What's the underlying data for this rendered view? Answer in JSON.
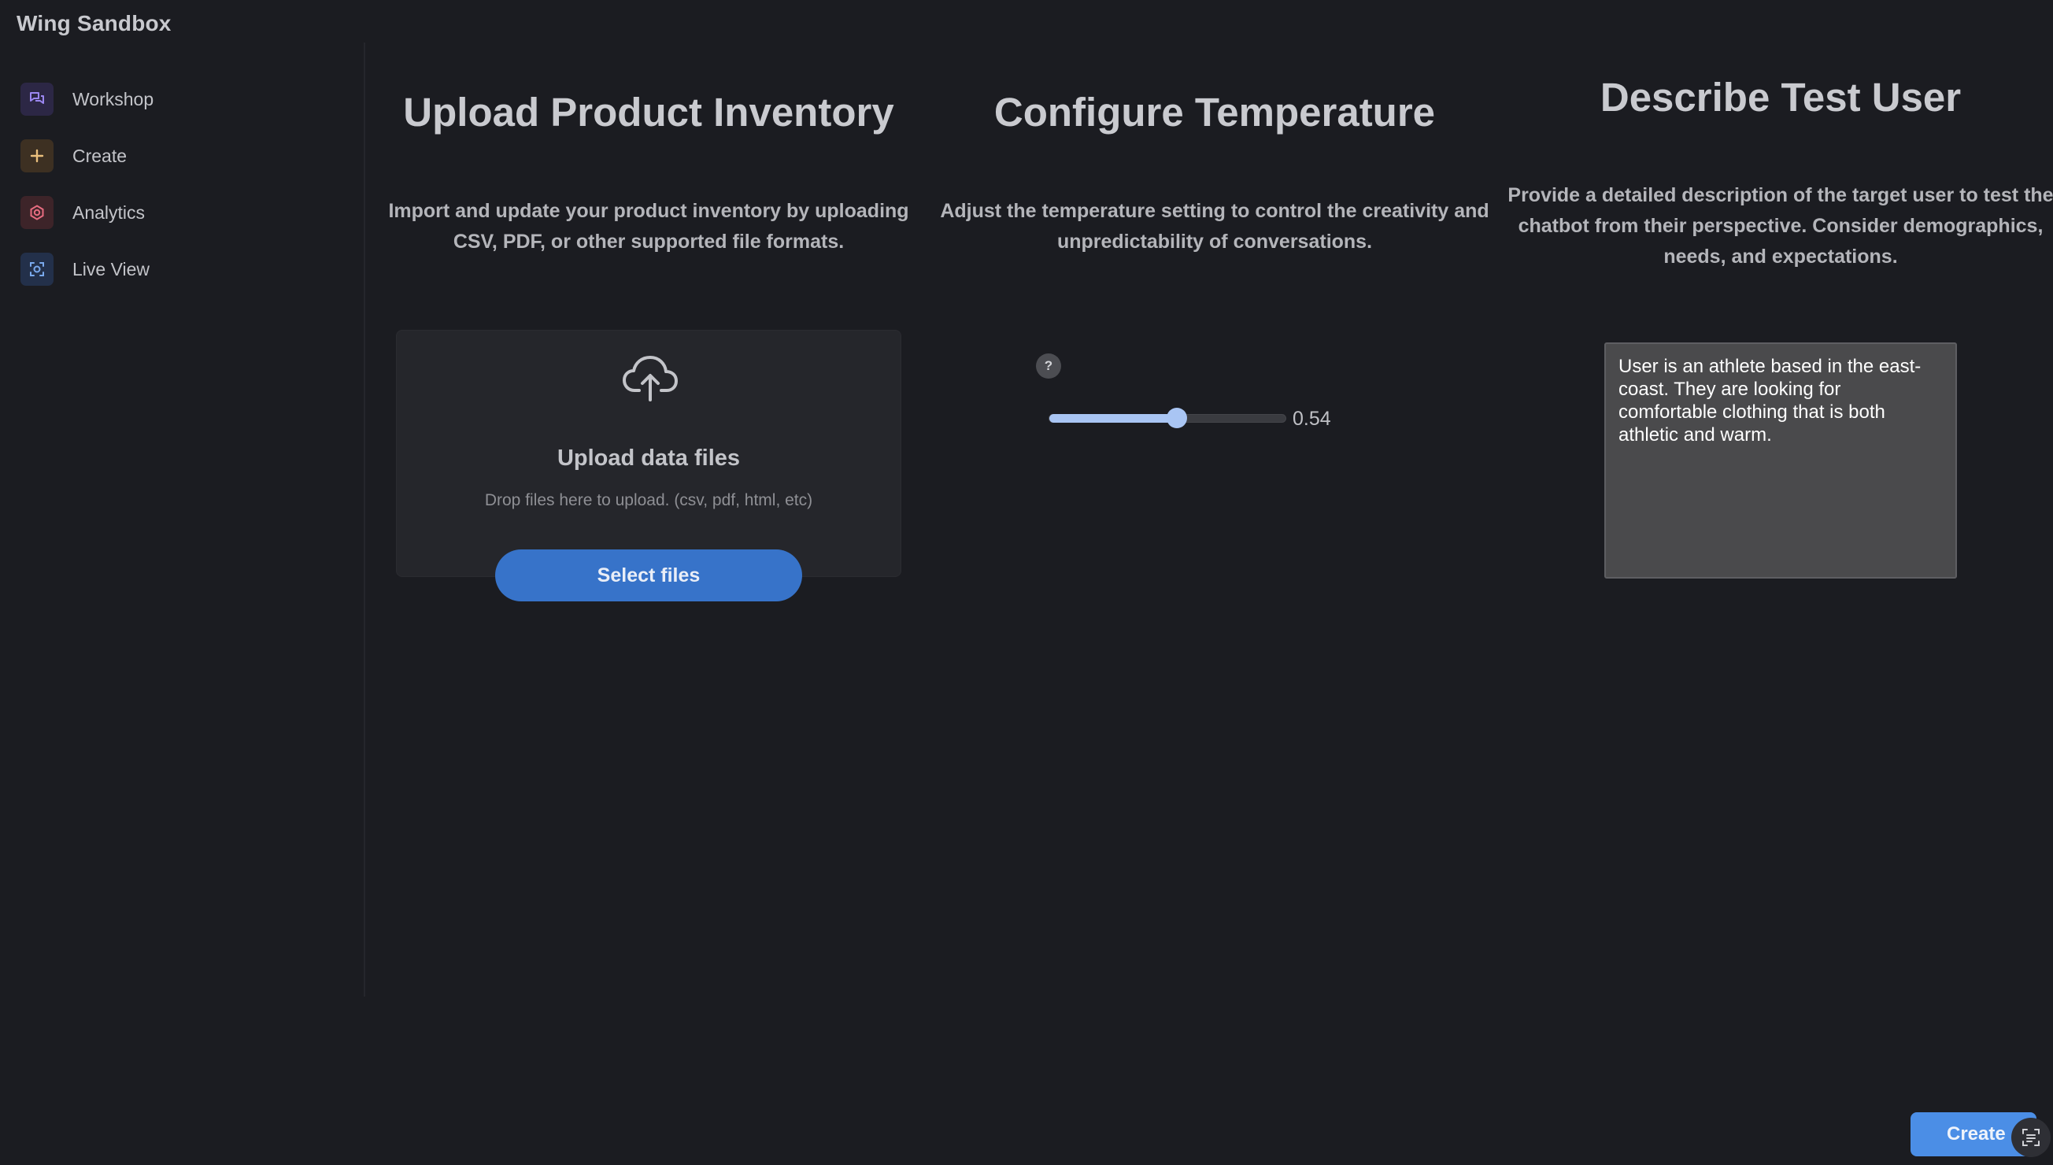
{
  "app": {
    "title": "Wing Sandbox"
  },
  "sidebar": {
    "items": [
      {
        "label": "Workshop",
        "icon": "chat-bubbles-icon",
        "color": "#8f7be6"
      },
      {
        "label": "Create",
        "icon": "plus-icon",
        "color": "#e8b56a"
      },
      {
        "label": "Analytics",
        "icon": "target-icon",
        "color": "#e06a7c"
      },
      {
        "label": "Live View",
        "icon": "scan-focus-icon",
        "color": "#6a9fe6"
      }
    ]
  },
  "sections": {
    "upload": {
      "title": "Upload Product Inventory",
      "description": "Import and update your product inventory by uploading CSV, PDF, or other supported file formats.",
      "card_heading": "Upload data files",
      "card_hint": "Drop files here to upload. (csv, pdf, html, etc)",
      "button_label": "Select files"
    },
    "temperature": {
      "title": "Configure Temperature",
      "description": "Adjust the temperature setting to control the creativity and unpredictability of conversations.",
      "help_label": "?",
      "value": 0.54,
      "value_label": "0.54"
    },
    "test_user": {
      "title": "Describe Test User",
      "description": "Provide a detailed description of the target user to test the chatbot from their perspective. Consider demographics, needs, and expectations.",
      "textarea_value": "User is an athlete based in the east-coast. They are looking for comfortable clothing that is both athletic and warm."
    }
  },
  "footer": {
    "create_label": "Create"
  },
  "colors": {
    "accent": "#3773c9",
    "slider": "#a9c5f3",
    "background": "#1b1c21"
  }
}
